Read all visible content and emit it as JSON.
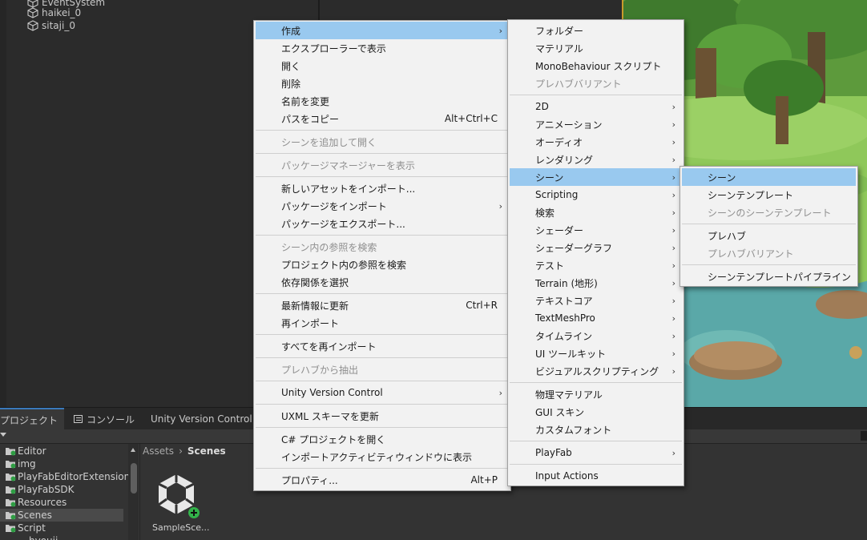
{
  "hierarchy": {
    "items": [
      "EventSystem",
      "haikei_0",
      "sitaji_0"
    ]
  },
  "tabs": {
    "project": "プロジェクト",
    "console": "コンソール",
    "uvc": "Unity Version Control"
  },
  "project_tree": {
    "items": [
      "Editor",
      "img",
      "PlayFabEditorExtensions",
      "PlayFabSDK",
      "Resources",
      "Scenes",
      "Script",
      "hyouji"
    ],
    "selected": "Scenes"
  },
  "breadcrumb": {
    "root": "Assets",
    "current": "Scenes"
  },
  "asset": {
    "label": "SampleSce..."
  },
  "menu1": {
    "items": [
      {
        "label": "作成",
        "submenu": true,
        "highlighted": true
      },
      {
        "label": "エクスプローラーで表示"
      },
      {
        "label": "開く"
      },
      {
        "label": "削除"
      },
      {
        "label": "名前を変更"
      },
      {
        "label": "パスをコピー",
        "shortcut": "Alt+Ctrl+C"
      },
      {
        "label": "シーンを追加して開く",
        "disabled": true
      },
      {
        "label": "パッケージマネージャーを表示",
        "disabled": true
      },
      {
        "label": "新しいアセットをインポート..."
      },
      {
        "label": "パッケージをインポート",
        "submenu": true
      },
      {
        "label": "パッケージをエクスポート..."
      },
      {
        "label": "シーン内の参照を検索",
        "disabled": true
      },
      {
        "label": "プロジェクト内の参照を検索"
      },
      {
        "label": "依存関係を選択"
      },
      {
        "label": "最新情報に更新",
        "shortcut": "Ctrl+R"
      },
      {
        "label": "再インポート"
      },
      {
        "label": "すべてを再インポート"
      },
      {
        "label": "プレハブから抽出",
        "disabled": true
      },
      {
        "label": "Unity Version Control",
        "submenu": true
      },
      {
        "label": "UXML スキーマを更新"
      },
      {
        "label": "C# プロジェクトを開く"
      },
      {
        "label": "インポートアクティビティウィンドウに表示"
      },
      {
        "label": "プロパティ...",
        "shortcut": "Alt+P"
      }
    ]
  },
  "menu2": {
    "items": [
      {
        "label": "フォルダー"
      },
      {
        "label": "マテリアル"
      },
      {
        "label": "MonoBehaviour スクリプト"
      },
      {
        "label": "プレハブバリアント",
        "disabled": true
      },
      {
        "label": "2D",
        "submenu": true
      },
      {
        "label": "アニメーション",
        "submenu": true
      },
      {
        "label": "オーディオ",
        "submenu": true
      },
      {
        "label": "レンダリング",
        "submenu": true
      },
      {
        "label": "シーン",
        "submenu": true,
        "highlighted": true
      },
      {
        "label": "Scripting",
        "submenu": true
      },
      {
        "label": "検索",
        "submenu": true
      },
      {
        "label": "シェーダー",
        "submenu": true
      },
      {
        "label": "シェーダーグラフ",
        "submenu": true
      },
      {
        "label": "テスト",
        "submenu": true
      },
      {
        "label": "Terrain (地形)",
        "submenu": true
      },
      {
        "label": "テキストコア",
        "submenu": true
      },
      {
        "label": "TextMeshPro",
        "submenu": true
      },
      {
        "label": "タイムライン",
        "submenu": true
      },
      {
        "label": "UI ツールキット",
        "submenu": true
      },
      {
        "label": "ビジュアルスクリプティング",
        "submenu": true
      },
      {
        "label": "物理マテリアル"
      },
      {
        "label": "GUI スキン"
      },
      {
        "label": "カスタムフォント"
      },
      {
        "label": "PlayFab",
        "submenu": true
      },
      {
        "label": "Input Actions"
      }
    ]
  },
  "menu3": {
    "items": [
      {
        "label": "シーン",
        "highlighted": true
      },
      {
        "label": "シーンテンプレート"
      },
      {
        "label": "シーンのシーンテンプレート",
        "disabled": true
      },
      {
        "label": "プレハブ"
      },
      {
        "label": "プレハブバリアント",
        "disabled": true
      },
      {
        "label": "シーンテンプレートパイプライン"
      }
    ]
  },
  "colors": {
    "menu_bg": "#f2f2f2",
    "menu_highlight": "#99c9ef",
    "editor_bg": "#383838",
    "active_tab_accent": "#3a79bb"
  }
}
